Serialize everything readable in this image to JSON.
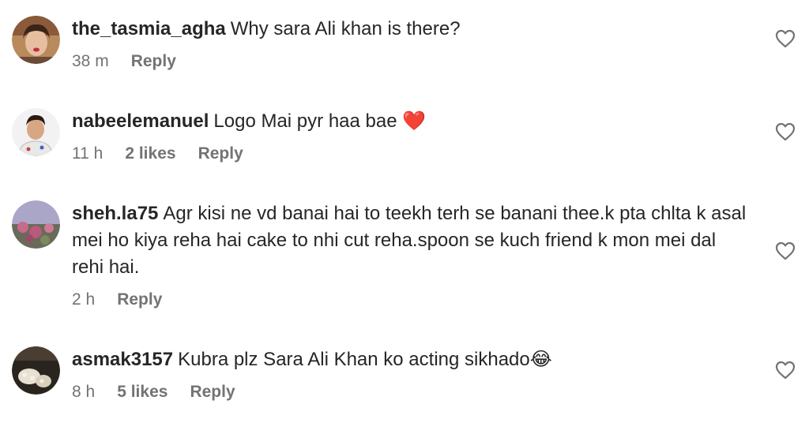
{
  "comments": [
    {
      "username": "the_tasmia_agha",
      "text": "Why sara Ali khan is there?",
      "time": "38 m",
      "likes": "",
      "reply": "Reply"
    },
    {
      "username": "nabeelemanuel",
      "text": "Logo Mai pyr haa bae ❤️",
      "time": "11 h",
      "likes": "2 likes",
      "reply": "Reply"
    },
    {
      "username": "sheh.la75",
      "text": "Agr kisi ne vd banai hai to teekh terh se banani thee.k pta chlta k asal mei ho kiya reha hai cake to nhi cut reha.spoon se kuch friend k mon mei dal rehi hai.",
      "time": "2 h",
      "likes": "",
      "reply": "Reply"
    },
    {
      "username": "asmak3157",
      "text": "Kubra plz Sara Ali Khan ko acting sikhado😂",
      "time": "8 h",
      "likes": "5 likes",
      "reply": "Reply"
    }
  ],
  "icons": {
    "like": "heart-outline-icon"
  },
  "colors": {
    "text": "#262626",
    "meta": "#737373"
  }
}
